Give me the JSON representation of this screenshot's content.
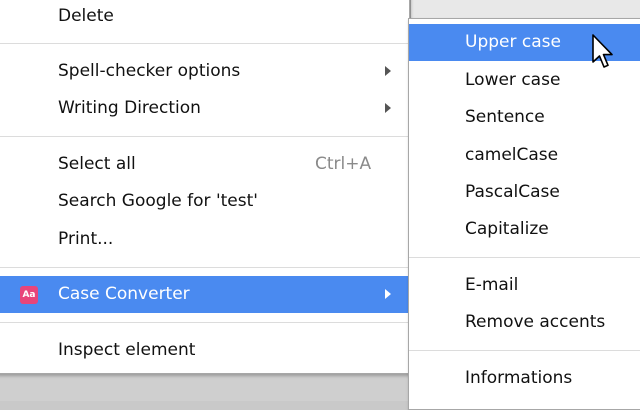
{
  "context_menu": {
    "items": [
      {
        "label": "Delete"
      },
      {
        "label": "Spell-checker options"
      },
      {
        "label": "Writing Direction"
      },
      {
        "label": "Select all",
        "shortcut": "Ctrl+A"
      },
      {
        "label": "Search Google for 'test'"
      },
      {
        "label": "Print..."
      },
      {
        "label": "Case Converter",
        "icon": "Aa"
      },
      {
        "label": "Inspect element"
      }
    ]
  },
  "submenu": {
    "items": [
      {
        "label": "Upper case"
      },
      {
        "label": "Lower case"
      },
      {
        "label": "Sentence"
      },
      {
        "label": "camelCase"
      },
      {
        "label": "PascalCase"
      },
      {
        "label": "Capitalize"
      },
      {
        "label": "E-mail"
      },
      {
        "label": "Remove accents"
      },
      {
        "label": "Informations"
      }
    ]
  },
  "colors": {
    "highlight": "#4a8af0",
    "extension_icon": "#e8457a"
  }
}
